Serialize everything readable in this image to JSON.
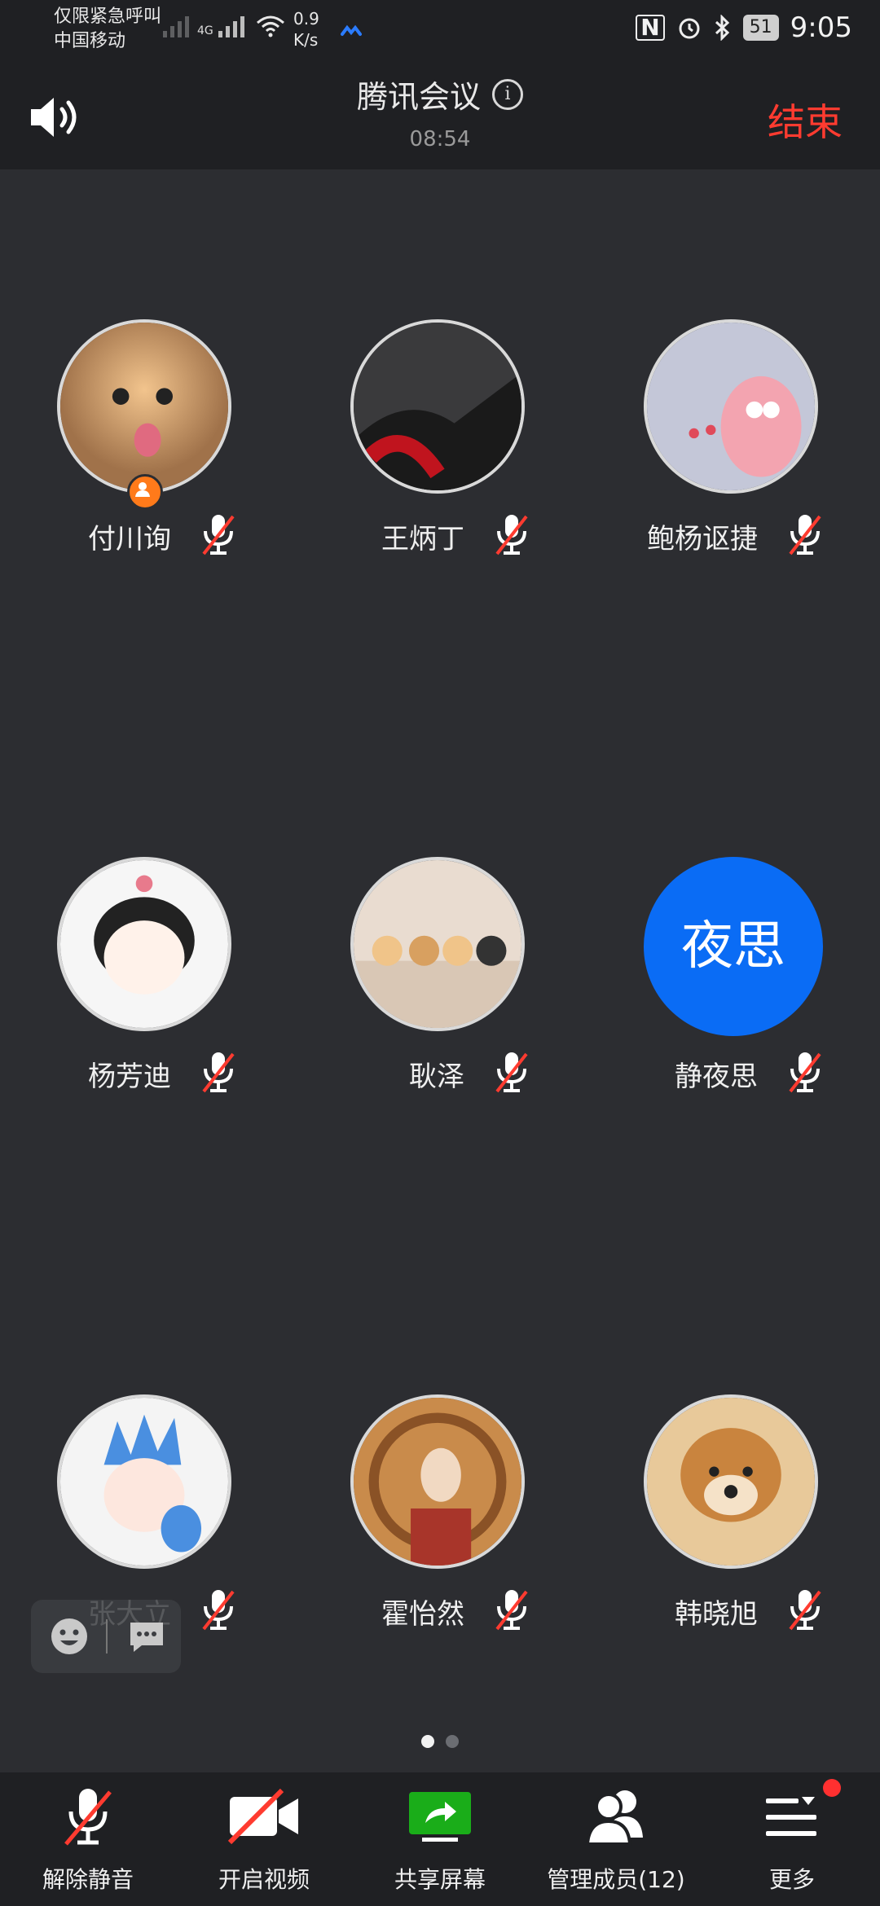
{
  "status_bar": {
    "line1": "仅限紧急呼叫",
    "line2": "中国移动",
    "network": "4G",
    "speed_value": "0.9",
    "speed_unit": "K/s",
    "battery": "51",
    "time": "9:05"
  },
  "header": {
    "title": "腾讯会议",
    "timer": "08:54",
    "end_label": "结束"
  },
  "participants": [
    {
      "name": "付川询",
      "muted": true,
      "host": true
    },
    {
      "name": "王炳丁",
      "muted": true
    },
    {
      "name": "鲍杨讴捷",
      "muted": true
    },
    {
      "name": "杨芳迪",
      "muted": true
    },
    {
      "name": "耿泽",
      "muted": true
    },
    {
      "name": "静夜思",
      "muted": true,
      "initials": "夜思"
    },
    {
      "name": "张大立",
      "muted": true
    },
    {
      "name": "霍怡然",
      "muted": true
    },
    {
      "name": "韩晓旭",
      "muted": true
    }
  ],
  "pagination": {
    "current": 1,
    "total": 2
  },
  "toolbar": {
    "unmute": "解除静音",
    "video": "开启视频",
    "share": "共享屏幕",
    "members": "管理成员(12)",
    "more": "更多"
  },
  "colors": {
    "background": "#2c2d31",
    "bar": "#1f2023",
    "end_red": "#ff3b30",
    "initials_blue": "#0a6cf5",
    "share_green": "#1aad19"
  }
}
